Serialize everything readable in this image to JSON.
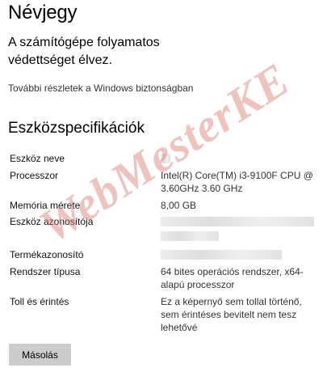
{
  "header": {
    "title": "Névjegy"
  },
  "protection": {
    "line1": "A számítógépe folyamatos",
    "line2": "védettséget élvez.",
    "link": "További részletek a Windows biztonságban"
  },
  "specs": {
    "heading": "Eszközspecifikációk",
    "device_name": {
      "label": "Eszköz neve",
      "value": ""
    },
    "processor": {
      "label": "Processzor",
      "value_line1": "Intel(R) Core(TM) i3-9100F CPU @",
      "value_line2": "3.60GHz   3.60 GHz"
    },
    "memory": {
      "label": "Memória mérete",
      "value": "8,00 GB"
    },
    "device_id": {
      "label": "Eszköz azonosítója",
      "value": ""
    },
    "product_id": {
      "label": "Termékazonosító",
      "value": ""
    },
    "system_type": {
      "label": "Rendszer típusa",
      "value_line1": "64 bites operációs rendszer, x64-",
      "value_line2": "alapú processzor"
    },
    "pen_touch": {
      "label": "Toll és érintés",
      "value_line1": "Ez a képernyő sem tollal történő,",
      "value_line2": "sem érintéses bevitelt nem tesz",
      "value_line3": "lehetővé"
    }
  },
  "actions": {
    "copy_label": "Másolás"
  },
  "watermark": {
    "text": "WebMesterKE",
    "color": "#dc786e"
  }
}
